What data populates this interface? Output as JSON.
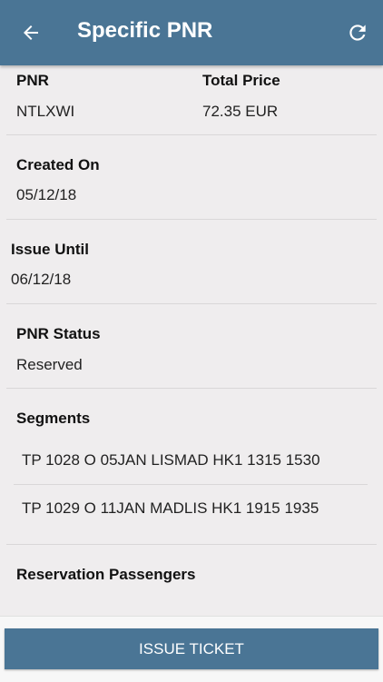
{
  "header": {
    "title": "Specific PNR"
  },
  "pnr": {
    "label": "PNR",
    "value": "NTLXWI"
  },
  "total_price": {
    "label": "Total Price",
    "value": "72.35 EUR"
  },
  "created_on": {
    "label": "Created On",
    "value": "05/12/18"
  },
  "issue_until": {
    "label": "Issue Until",
    "value": "06/12/18"
  },
  "pnr_status": {
    "label": "PNR Status",
    "value": "Reserved"
  },
  "segments": {
    "label": "Segments",
    "items": [
      "TP 1028 O 05JAN LISMAD HK1 1315 1530",
      "TP 1029 O 11JAN MADLIS HK1 1915 1935"
    ]
  },
  "reservation_passengers": {
    "label": "Reservation Passengers"
  },
  "footer": {
    "issue_button": "ISSUE TICKET"
  },
  "colors": {
    "primary": "#4a7595",
    "background": "#efedee"
  },
  "icons": {
    "back": "arrow-left-icon",
    "refresh": "refresh-icon"
  }
}
